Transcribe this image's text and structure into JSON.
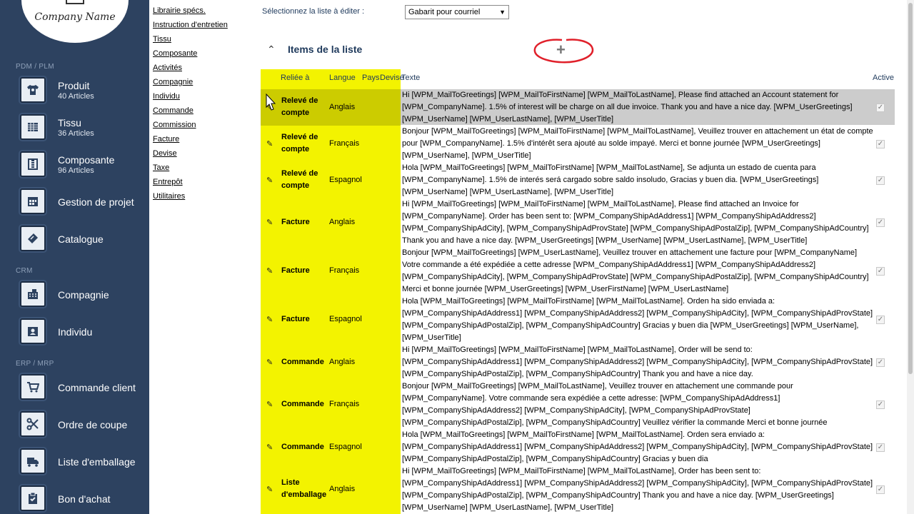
{
  "app": {
    "company_name": "Company Name"
  },
  "sidebar": {
    "sections": {
      "pdm": "PDM / PLM",
      "crm": "CRM",
      "erp": "ERP / MRP"
    },
    "items": [
      {
        "label": "Produit",
        "sub": "40 Articles",
        "icon": "tshirt-icon"
      },
      {
        "label": "Tissu",
        "sub": "36 Articles",
        "icon": "fabric-icon"
      },
      {
        "label": "Composante",
        "sub": "96 Articles",
        "icon": "zipper-icon"
      },
      {
        "label": "Gestion de projet",
        "sub": "",
        "icon": "calendar-icon"
      },
      {
        "label": "Catalogue",
        "sub": "",
        "icon": "catalog-icon"
      },
      {
        "label": "Compagnie",
        "sub": "",
        "icon": "building-icon"
      },
      {
        "label": "Individu",
        "sub": "",
        "icon": "id-card-icon"
      },
      {
        "label": "Commande client",
        "sub": "",
        "icon": "cart-icon"
      },
      {
        "label": "Ordre de coupe",
        "sub": "",
        "icon": "scissors-icon"
      },
      {
        "label": "Liste d'emballage",
        "sub": "",
        "icon": "truck-icon"
      },
      {
        "label": "Bon d'achat",
        "sub": "",
        "icon": "clipboard-check-icon"
      }
    ]
  },
  "links": [
    "Librairie spécs.",
    "Instruction d'entretien",
    "Tissu",
    "Composante",
    "Activités",
    "Compagnie",
    "Individu",
    "Commande",
    "Commission",
    "Facture",
    "Devise",
    "Taxe",
    "Entrepôt",
    "Utilitaires"
  ],
  "editor": {
    "select_label": "Sélectionnez la liste à éditer :",
    "select_value": "Gabarit pour courriel",
    "panel_title": "Items de la liste",
    "add_symbol": "+",
    "collapse_symbol": "^"
  },
  "table": {
    "headers": {
      "linked": "Reliée à",
      "language": "Langue",
      "country": "Pays",
      "currency": "Devise",
      "text": "Texte",
      "active": "Active"
    },
    "rows": [
      {
        "linked": "Relevé de compte",
        "language": "Anglais",
        "active": true,
        "text": "Hi [WPM_MailToGreetings] [WPM_MailToFirstName] [WPM_MailToLastName], Please find attached an Account statement for [WPM_CompanyName]. 1.5% of interest will be charge on all due invoice. Thank you and have a nice day. [WPM_UserGreetings] [WPM_UserName] [WPM_UserLastName], [WPM_UserTitle]"
      },
      {
        "linked": "Relevé de compte",
        "language": "Français",
        "active": true,
        "text": "Bonjour [WPM_MailToGreetings] [WPM_MailToFirstName] [WPM_MailToLastName], Veuillez trouver en attachement un état de compte pour [WPM_CompanyName]. 1.5% d'intérêt sera ajouté au solde impayé. Merci et bonne journée [WPM_UserGreetings] [WPM_UserName], [WPM_UserTitle]"
      },
      {
        "linked": "Relevé de compte",
        "language": "Espagnol",
        "active": true,
        "text": "Hola [WPM_MailToGreetings] [WPM_MailToFirstName] [WPM_MailToLastName], Se adjunta un estado de cuenta para [WPM_CompanyName]. 1.5% de interés será cargado sobre saldo insoludo, Gracias y buen dia. [WPM_UserGreetings] [WPM_UserName] [WPM_UserLastName], [WPM_UserTitle]"
      },
      {
        "linked": "Facture",
        "language": "Anglais",
        "active": true,
        "text": "Hi [WPM_MailToGreetings] [WPM_MailToFirstName] [WPM_MailToLastName], Please find attached an Invoice for [WPM_CompanyName]. Order has been sent to: [WPM_CompanyShipAdAddress1] [WPM_CompanyShipAdAddress2] [WPM_CompanyShipAdCity], [WPM_CompanyShipAdProvState] [WPM_CompanyShipAdPostalZip], [WPM_CompanyShipAdCountry] Thank you and have a nice day. [WPM_UserGreetings] [WPM_UserName] [WPM_UserLastName], [WPM_UserTitle]"
      },
      {
        "linked": "Facture",
        "language": "Français",
        "active": true,
        "text": "Bonjour [WPM_MailToGreetings] [WPM_UserLastName], Veuillez trouver en attachement une facture pour [WPM_CompanyName] Votre commande a été expédiée a cette adresse [WPM_CompanyShipAdAddress1] [WPM_CompanyShipAdAddress2] [WPM_CompanyShipAdCity], [WPM_CompanyShipAdProvState] [WPM_CompanyShipAdPostalZip], [WPM_CompanyShipAdCountry] Merci et bonne journée [WPM_UserGreetings] [WPM_UserFirstName] [WPM_UserLastName]"
      },
      {
        "linked": "Facture",
        "language": "Espagnol",
        "active": true,
        "text": "Hola [WPM_MailToGreetings] [WPM_MailToFirstName] [WPM_MailToLastName]. Orden ha sido enviada a: [WPM_CompanyShipAdAddress1] [WPM_CompanyShipAdAddress2] [WPM_CompanyShipAdCity], [WPM_CompanyShipAdProvState] [WPM_CompanyShipAdPostalZip], [WPM_CompanyShipAdCountry] Gracias y buen dia [WPM_UserGreetings] [WPM_UserName], [WPM_UserTitle]"
      },
      {
        "linked": "Commande",
        "language": "Anglais",
        "active": true,
        "text": "Hi [WPM_MailToGreetings] [WPM_MailToFirstName] [WPM_MailToLastName], Order will be send to: [WPM_CompanyShipAdAddress1] [WPM_CompanyShipAdAddress2] [WPM_CompanyShipAdCity], [WPM_CompanyShipAdProvState] [WPM_CompanyShipAdPostalZip], [WPM_CompanyShipAdCountry] Thank you and have a nice day."
      },
      {
        "linked": "Commande",
        "language": "Français",
        "active": true,
        "text": "Bonjour [WPM_MailToGreetings] [WPM_MailToLastName], Veuillez trouver en attachement une commande pour [WPM_CompanyName]. Votre commande sera expédiée a cette adresse: [WPM_CompanyShipAdAddress1] [WPM_CompanyShipAdAddress2] [WPM_CompanyShipAdCity], [WPM_CompanyShipAdProvState] [WPM_CompanyShipAdPostalZip], [WPM_CompanyShipAdCountry] Veuillez vérifier la commande Merci et bonne journée"
      },
      {
        "linked": "Commande",
        "language": "Espagnol",
        "active": true,
        "text": "Hola [WPM_MailToGreetings] [WPM_MailToFirstName] [WPM_MailToLastName]. Orden sera enviado a: [WPM_CompanyShipAdAddress1] [WPM_CompanyShipAdAddress2] [WPM_CompanyShipAdCity], [WPM_CompanyShipAdProvState] [WPM_CompanyShipAdPostalZip], [WPM_CompanyShipAdCountry] Gracias y buen dia"
      },
      {
        "linked": "Liste d'emballage",
        "language": "Anglais",
        "active": true,
        "text": "Hi [WPM_MailToGreetings] [WPM_MailToFirstName] [WPM_MailToLastName], Order has been sent to: [WPM_CompanyShipAdAddress1] [WPM_CompanyShipAdAddress2] [WPM_CompanyShipAdCity], [WPM_CompanyShipAdProvState] [WPM_CompanyShipAdPostalZip], [WPM_CompanyShipAdCountry] Thank you and have a nice day. [WPM_UserGreetings] [WPM_UserName] [WPM_UserLastName], [WPM_UserTitle]"
      }
    ]
  }
}
